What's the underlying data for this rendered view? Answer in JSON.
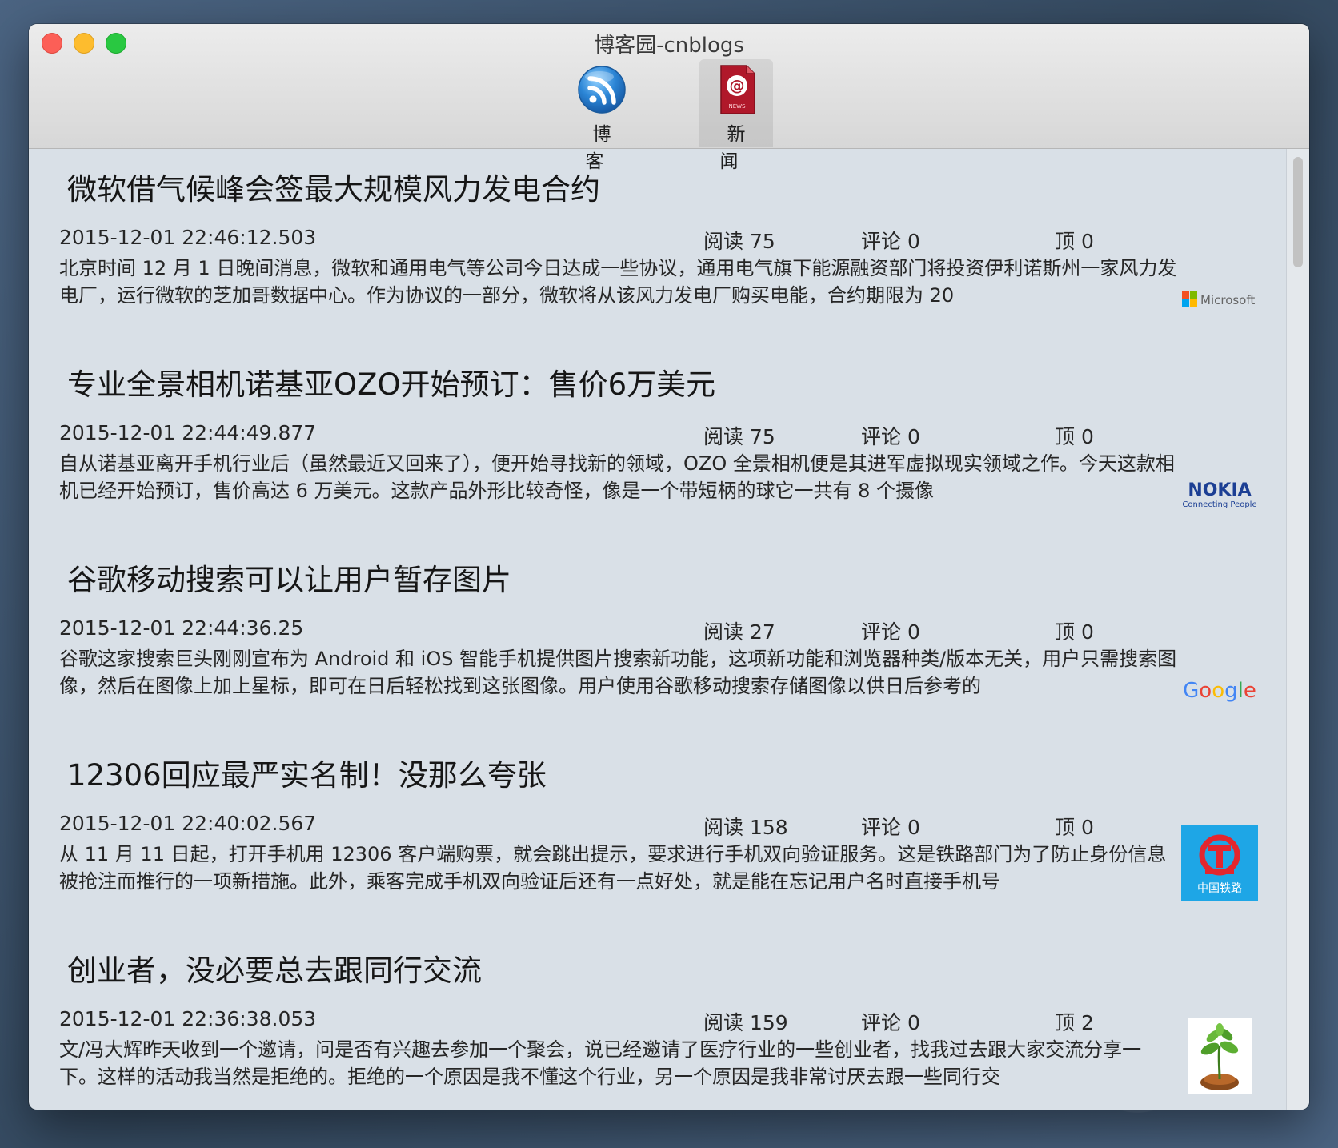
{
  "window": {
    "title": "博客园-cnblogs"
  },
  "toolbar": {
    "items": [
      {
        "label": "博客",
        "icon": "rss-icon",
        "active": false
      },
      {
        "label": "新闻",
        "icon": "news-icon",
        "active": true
      }
    ]
  },
  "articles": [
    {
      "title": "微软借气候峰会签最大规模风力发电合约",
      "date": "2015-12-01 22:46:12.503",
      "reads": "阅读 75",
      "comments": "评论 0",
      "diggs": "顶 0",
      "summary": "北京时间 12 月 1 日晚间消息，微软和通用电气等公司今日达成一些协议，通用电气旗下能源融资部门将投资伊利诺斯州一家风力发电厂，运行微软的芝加哥数据中心。作为协议的一部分，微软将从该风力发电厂购买电能，合约期限为 20",
      "thumb": "microsoft-logo",
      "thumb_text": "Microsoft"
    },
    {
      "title": "专业全景相机诺基亚OZO开始预订：售价6万美元",
      "date": "2015-12-01 22:44:49.877",
      "reads": "阅读 75",
      "comments": "评论 0",
      "diggs": "顶 0",
      "summary": "自从诺基亚离开手机行业后（虽然最近又回来了），便开始寻找新的领域，OZO 全景相机便是其进军虚拟现实领域之作。今天这款相机已经开始预订，售价高达 6 万美元。这款产品外形比较奇怪，像是一个带短柄的球它一共有 8 个摄像",
      "thumb": "nokia-logo",
      "thumb_text": "NOKIA",
      "thumb_subtext": "Connecting People"
    },
    {
      "title": "谷歌移动搜索可以让用户暂存图片",
      "date": "2015-12-01 22:44:36.25",
      "reads": "阅读 27",
      "comments": "评论 0",
      "diggs": "顶 0",
      "summary": "谷歌这家搜索巨头刚刚宣布为 Android 和 iOS 智能手机提供图片搜索新功能，这项新功能和浏览器种类/版本无关，用户只需搜索图像，然后在图像上加上星标，即可在日后轻松找到这张图像。用户使用谷歌移动搜索存储图像以供日后参考的",
      "thumb": "google-logo",
      "thumb_text": "Google"
    },
    {
      "title": "12306回应最严实名制！没那么夸张",
      "date": "2015-12-01 22:40:02.567",
      "reads": "阅读 158",
      "comments": "评论 0",
      "diggs": "顶 0",
      "summary": "从 11 月 11 日起，打开手机用 12306 客户端购票，就会跳出提示，要求进行手机双向验证服务。这是铁路部门为了防止身份信息被抢注而推行的一项新措施。此外，乘客完成手机双向验证后还有一点好处，就是能在忘记用户名时直接手机号",
      "thumb": "china-railway-logo",
      "thumb_text": "中国铁路"
    },
    {
      "title": "创业者，没必要总去跟同行交流",
      "date": "2015-12-01 22:36:38.053",
      "reads": "阅读 159",
      "comments": "评论 0",
      "diggs": "顶 2",
      "summary": "文/冯大辉昨天收到一个邀请，问是否有兴趣去参加一个聚会，说已经邀请了医疗行业的一些创业者，找我过去跟大家交流分享一下。这样的活动我当然是拒绝的。拒绝的一个原因是我不懂这个行业，另一个原因是我非常讨厌去跟一些同行交",
      "thumb": "seedling-image"
    }
  ]
}
